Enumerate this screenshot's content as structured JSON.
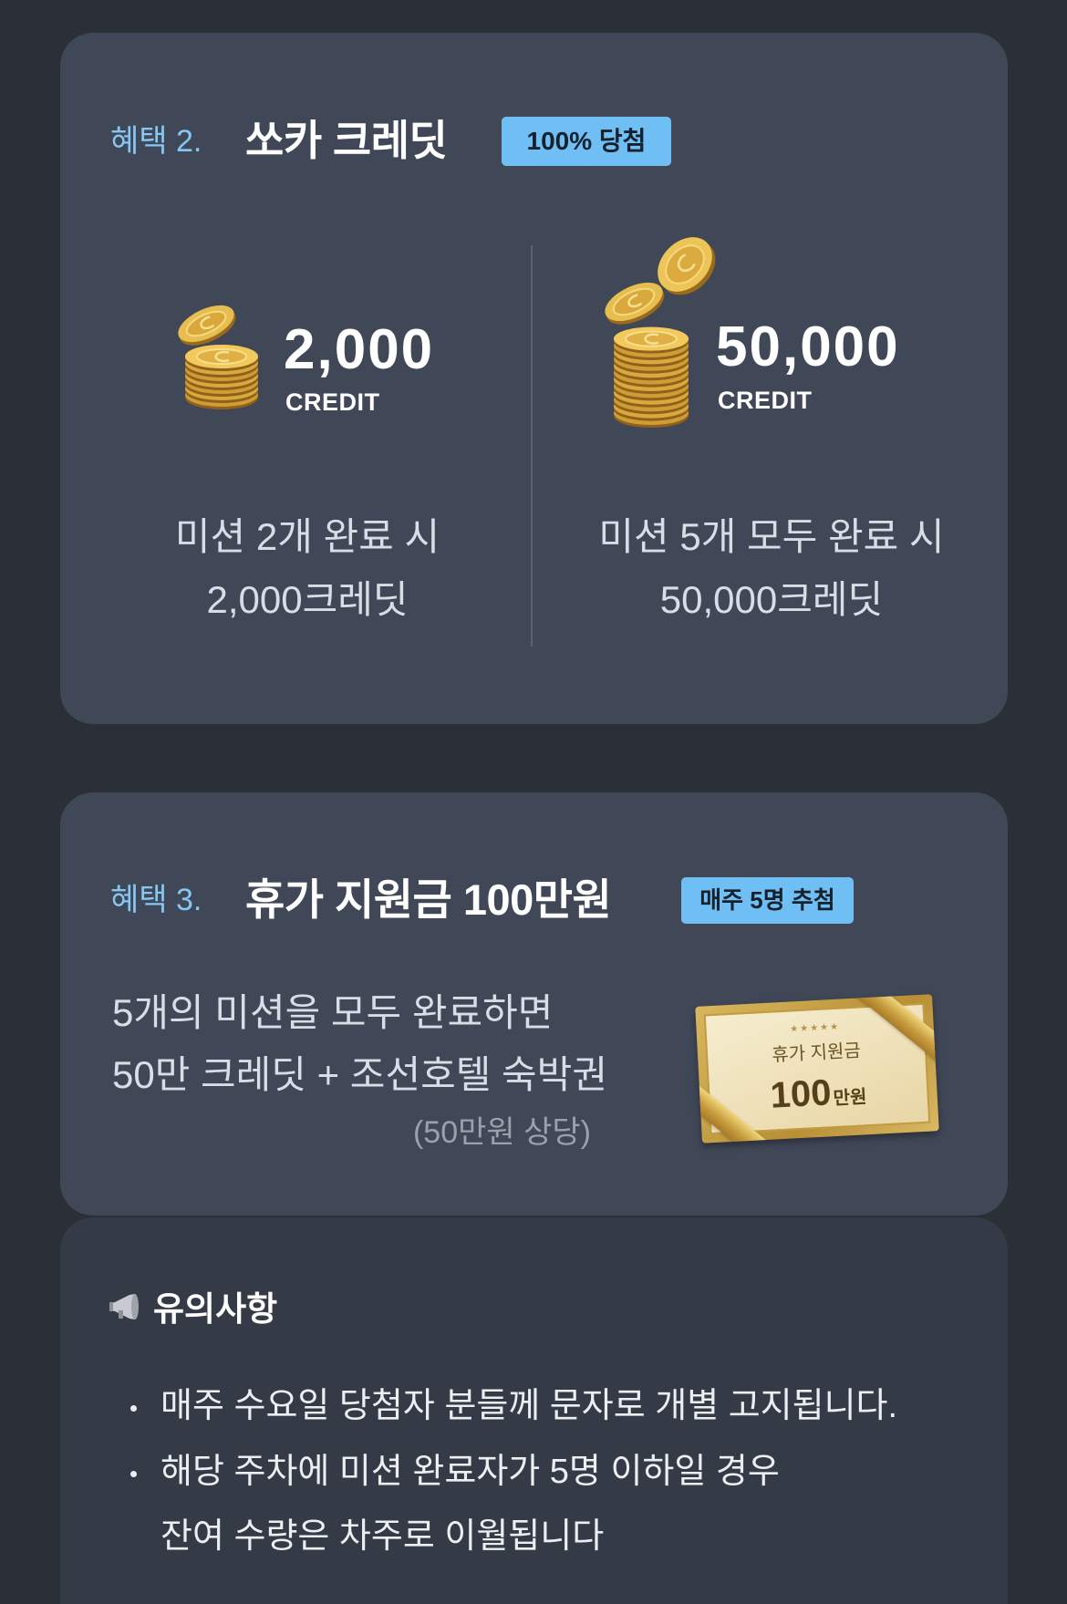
{
  "colors": {
    "background": "#2b2f36",
    "card": "#404757",
    "notice_card": "#353b46",
    "label_blue": "#86c6f2",
    "badge_blue": "#70bff4",
    "text_light": "#d9dde5",
    "text_muted": "#9aa1ac",
    "gold": "#e3b447"
  },
  "benefit_credit": {
    "label": "혜택 2.",
    "title": "쏘카 크레딧",
    "badge": "100% 당첨",
    "tiers": [
      {
        "icon": "coin-stack-icon",
        "amount": "2,000",
        "unit": "CREDIT",
        "desc": [
          "미션 2개 완료 시",
          "2,000크레딧"
        ]
      },
      {
        "icon": "coin-stack-large-icon",
        "amount": "50,000",
        "unit": "CREDIT",
        "desc": [
          "미션 5개 모두 완료 시",
          "50,000크레딧"
        ]
      }
    ]
  },
  "benefit_vacation": {
    "label": "혜택 3.",
    "title": "휴가 지원금 100만원",
    "badge": "매주 5명 추첨",
    "desc": [
      "5개의 미션을 모두 완료하면",
      "50만 크레딧 + 조선호텔 숙박권"
    ],
    "note": "(50만원 상당)",
    "voucher": {
      "stars": "★★★★★",
      "title": "휴가 지원금",
      "amount": "100",
      "unit": "만원"
    }
  },
  "notice": {
    "icon": "megaphone-icon",
    "title": "유의사항",
    "items": [
      {
        "lines": [
          "매주 수요일 당첨자 분들께 문자로 개별 고지됩니다."
        ]
      },
      {
        "lines": [
          "해당 주차에 미션 완료자가 5명 이하일 경우",
          "잔여 수량은 차주로 이월됩니다"
        ]
      }
    ]
  }
}
